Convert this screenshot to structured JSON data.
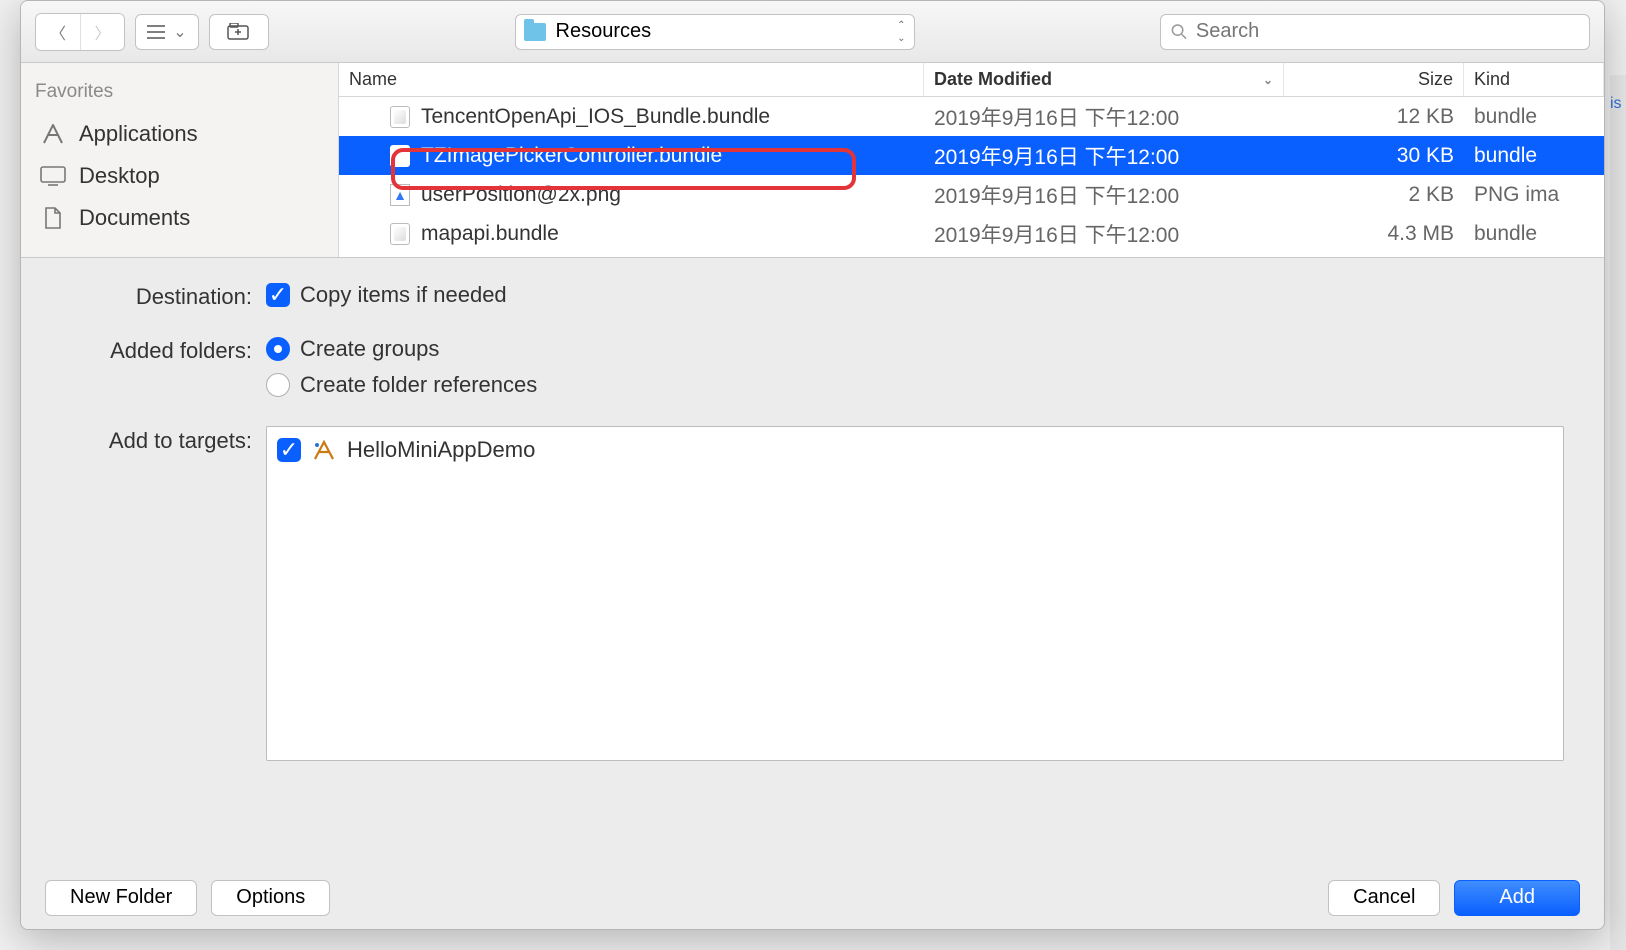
{
  "toolbar": {
    "location_label": "Resources",
    "search_placeholder": "Search"
  },
  "sidebar": {
    "heading": "Favorites",
    "items": [
      {
        "label": "Applications"
      },
      {
        "label": "Desktop"
      },
      {
        "label": "Documents"
      }
    ]
  },
  "columns": {
    "name": "Name",
    "date": "Date Modified",
    "size": "Size",
    "kind": "Kind"
  },
  "files": [
    {
      "name": "TencentOpenApi_IOS_Bundle.bundle",
      "date": "2019年9月16日 下午12:00",
      "size": "12 KB",
      "kind": "bundle",
      "type": "bundle",
      "selected": false
    },
    {
      "name": "TZImagePickerController.bundle",
      "date": "2019年9月16日 下午12:00",
      "size": "30 KB",
      "kind": "bundle",
      "type": "bundle",
      "selected": true
    },
    {
      "name": "userPosition@2x.png",
      "date": "2019年9月16日 下午12:00",
      "size": "2 KB",
      "kind": "PNG ima",
      "type": "png",
      "selected": false
    },
    {
      "name": "mapapi.bundle",
      "date": "2019年9月16日 下午12:00",
      "size": "4.3 MB",
      "kind": "bundle",
      "type": "bundle",
      "selected": false
    }
  ],
  "options": {
    "destination_label": "Destination:",
    "copy_items_label": "Copy items if needed",
    "added_folders_label": "Added folders:",
    "create_groups_label": "Create groups",
    "create_refs_label": "Create folder references",
    "add_targets_label": "Add to targets:",
    "target_name": "HelloMiniAppDemo"
  },
  "buttons": {
    "new_folder": "New Folder",
    "options": "Options",
    "cancel": "Cancel",
    "add": "Add"
  }
}
